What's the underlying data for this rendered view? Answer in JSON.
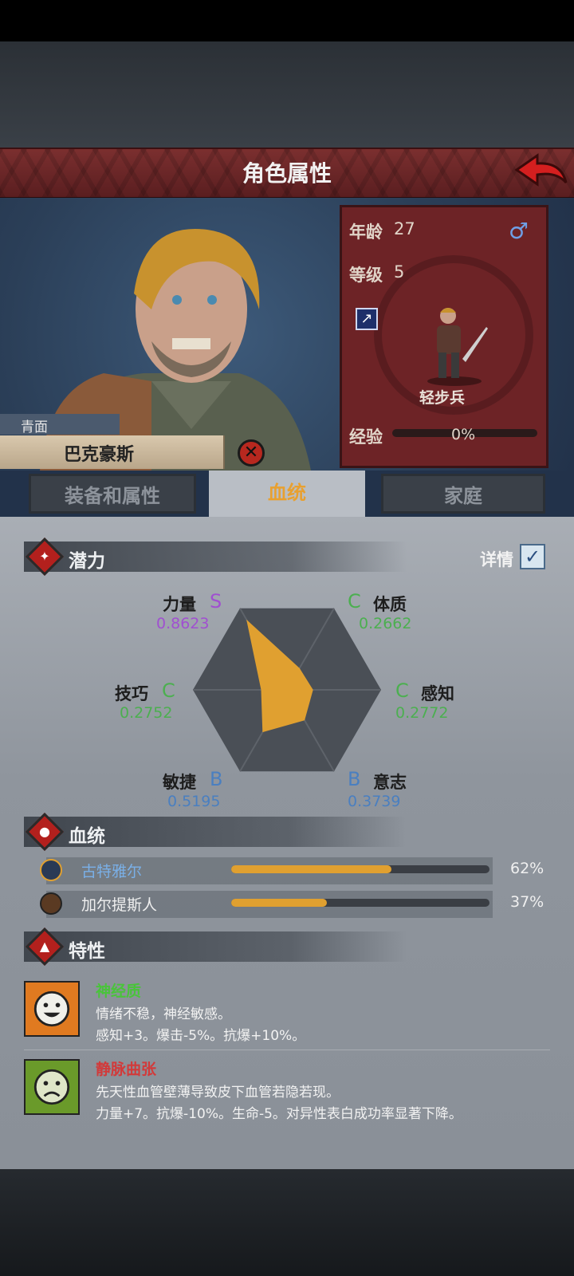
{
  "header": {
    "title": "角色属性"
  },
  "character": {
    "type_tag": "青面",
    "name": "巴克豪斯",
    "age_label": "年龄",
    "age": "27",
    "level_label": "等级",
    "level": "5",
    "class_name": "轻步兵",
    "exp_label": "经验",
    "exp_value": "0%",
    "gender_symbol": "♂"
  },
  "tabs": [
    {
      "label": "装备和属性",
      "active": false
    },
    {
      "label": "血统",
      "active": true
    },
    {
      "label": "家庭",
      "active": false
    }
  ],
  "potential": {
    "title": "潜力",
    "detail_label": "详情",
    "detail_checked": true,
    "stats": [
      {
        "name": "力量",
        "grade": "S",
        "value": "0.8623",
        "level": 0.8623
      },
      {
        "name": "体质",
        "grade": "C",
        "value": "0.2662",
        "level": 0.2662
      },
      {
        "name": "感知",
        "grade": "C",
        "value": "0.2772",
        "level": 0.2772
      },
      {
        "name": "意志",
        "grade": "B",
        "value": "0.3739",
        "level": 0.3739
      },
      {
        "name": "敏捷",
        "grade": "B",
        "value": "0.5195",
        "level": 0.5195
      },
      {
        "name": "技巧",
        "grade": "C",
        "value": "0.2752",
        "level": 0.2752
      }
    ]
  },
  "bloodline": {
    "title": "血统",
    "entries": [
      {
        "name": "古特雅尔",
        "percent": "62%",
        "fraction": 0.62
      },
      {
        "name": "加尔提斯人",
        "percent": "37%",
        "fraction": 0.37
      }
    ]
  },
  "traits": {
    "title": "特性",
    "items": [
      {
        "name": "神经质",
        "desc1": "情绪不稳，神经敏感。",
        "desc2": "感知+3。爆击-5%。抗爆+10%。"
      },
      {
        "name": "静脉曲张",
        "desc1": "先天性血管壁薄导致皮下血管若隐若现。",
        "desc2": "力量+7。抗爆-10%。生命-5。对异性表白成功率显著下降。"
      }
    ]
  },
  "colors": {
    "grade_S": "#a050d0",
    "grade_C": "#4caf50",
    "grade_B": "#4a7fc0",
    "radar_fill": "#e0a030",
    "trait_good": "#49c43a",
    "trait_bad": "#d23a3a"
  }
}
